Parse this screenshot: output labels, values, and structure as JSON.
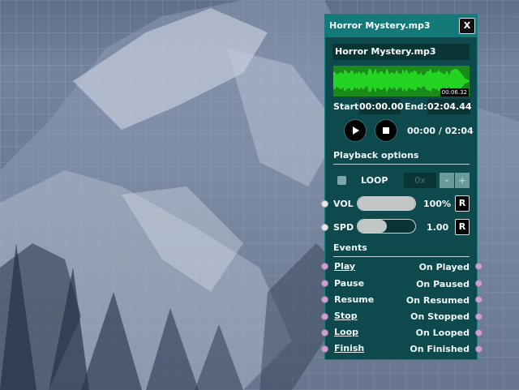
{
  "node": {
    "title": "Horror Mystery.mp3",
    "close_label": "X",
    "file_name": "Horror Mystery.mp3",
    "waveform_time": "00:06.32",
    "start_label": "Start:",
    "start_value": "00:00.00",
    "end_label": "End:",
    "end_value": "02:04.44",
    "play_icon": "play-icon",
    "stop_icon": "stop-icon",
    "playback_time": "00:00 / 02:04",
    "colors": {
      "header": "#137a79",
      "body": "#0e4a4d",
      "waveform": "#22d322",
      "port_event": "#caa2cd"
    }
  },
  "playback": {
    "section_label": "Playback options",
    "loop_label": "LOOP",
    "loop_checked": false,
    "loop_count": "0x",
    "minus_label": "-",
    "plus_label": "+",
    "vol_label": "VOL",
    "vol_value": "100%",
    "vol_level": 1.0,
    "spd_label": "SPD",
    "spd_value": "1.00",
    "spd_level": 0.5,
    "reset_label": "R"
  },
  "events": {
    "section_label": "Events",
    "inputs": [
      {
        "label": "Play"
      },
      {
        "label": "Pause"
      },
      {
        "label": "Resume"
      },
      {
        "label": "Stop"
      },
      {
        "label": "Loop"
      },
      {
        "label": "Finish"
      }
    ],
    "outputs": [
      {
        "label": "On Played"
      },
      {
        "label": "On Paused"
      },
      {
        "label": "On Resumed"
      },
      {
        "label": "On Stopped"
      },
      {
        "label": "On Looped"
      },
      {
        "label": "On Finished"
      }
    ]
  }
}
